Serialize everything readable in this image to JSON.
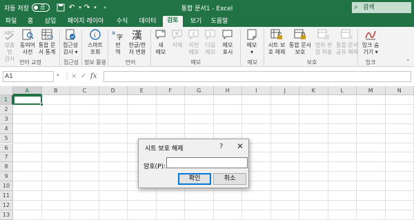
{
  "titlebar": {
    "autosave_label": "자동 저장",
    "autosave_state": "끔",
    "title": "통합 문서1  -  Excel",
    "search_label": "검색"
  },
  "tabs": [
    "파일",
    "홈",
    "삽입",
    "페이지 레이아웃",
    "수식",
    "데이터",
    "검토",
    "보기",
    "도움말"
  ],
  "active_tab": "검토",
  "ribbon": {
    "buttons": [
      {
        "l1": "맞춤법",
        "l2": "검사",
        "disabled": true
      },
      {
        "l1": "동의어",
        "l2": "사전",
        "disabled": false
      },
      {
        "l1": "통합 문",
        "l2": "서 통계",
        "disabled": false
      },
      {
        "l1": "접근성",
        "l2": "검사 ▾",
        "disabled": false
      },
      {
        "l1": "스마트",
        "l2": "조회",
        "disabled": false
      },
      {
        "l1": "번",
        "l2": "역",
        "disabled": false
      },
      {
        "l1": "한글/한",
        "l2": "자 변환",
        "disabled": false
      },
      {
        "l1": "새",
        "l2": "메모",
        "disabled": false
      },
      {
        "l1": "삭제",
        "l2": "",
        "disabled": true
      },
      {
        "l1": "이전",
        "l2": "메모",
        "disabled": true
      },
      {
        "l1": "다음",
        "l2": "메모",
        "disabled": true
      },
      {
        "l1": "메모",
        "l2": "표시",
        "disabled": false
      },
      {
        "l1": "메모",
        "l2": "▾",
        "disabled": false
      },
      {
        "l1": "시트 보",
        "l2": "호 해제",
        "disabled": false
      },
      {
        "l1": "통합 문서",
        "l2": "보호",
        "disabled": false
      },
      {
        "l1": "범위 편",
        "l2": "집 허용",
        "disabled": true
      },
      {
        "l1": "통합 문서",
        "l2": "공유 해제",
        "disabled": true
      },
      {
        "l1": "잉크 숨",
        "l2": "기기 ▾",
        "disabled": false
      }
    ],
    "groups": [
      "언어 교정",
      "접근성",
      "정보 활용",
      "언어",
      "메모",
      "메모",
      "보호",
      "잉크"
    ]
  },
  "formula_bar": {
    "name_box": "A1",
    "cancel_icon": "×",
    "enter_icon": "✓",
    "fx_icon": "fx"
  },
  "sheet": {
    "columns": [
      "A",
      "B",
      "C",
      "D",
      "E",
      "F",
      "G",
      "H",
      "I",
      "J",
      "K",
      "L",
      "M",
      "N"
    ],
    "rows": [
      "1",
      "2",
      "3",
      "4",
      "5",
      "6",
      "7",
      "8",
      "9",
      "10",
      "11",
      "12",
      "13"
    ],
    "selected_cell": "A1"
  },
  "dialog": {
    "title": "시트 보호 해제",
    "help": "?",
    "close": "✕",
    "password_label": "암호(P):",
    "password_value": "",
    "ok_label": "확인",
    "cancel_label": "취소"
  },
  "colors": {
    "brand_green": "#217346",
    "ribbon_bg": "#f3f3f3",
    "dialog_default_border": "#0078d7"
  }
}
